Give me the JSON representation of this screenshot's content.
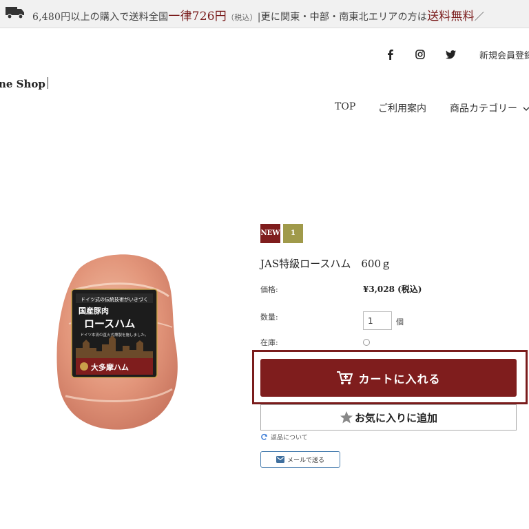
{
  "banner": {
    "truck_icon": "truck-icon",
    "part1": "6,480円以上の購入で送料全国",
    "highlight1": "一律726円",
    "tax": "（税込）",
    "part2": "|更に関東・中部・南東北エリアの方は",
    "highlight2": "送料無料",
    "end": "／"
  },
  "header": {
    "social_icons": [
      "facebook-icon",
      "instagram-icon",
      "twitter-icon"
    ],
    "register_label": "新規会員登録",
    "shop_name": "ne Shop"
  },
  "nav": {
    "items": [
      "TOP",
      "ご利用案内",
      "商品カテゴリー"
    ]
  },
  "product": {
    "badges": [
      "NEW",
      "1"
    ],
    "title": "JAS特級ロースハム　600ｇ",
    "price_label": "価格:",
    "price": "¥3,028 (税込)",
    "quantity_label": "数量:",
    "quantity_value": "1",
    "quantity_unit": "個",
    "stock_label": "在庫:",
    "package": {
      "line1": "ドイツ式の伝統技術がいきづく",
      "line2": "国産豚肉",
      "line3": "ロースハム",
      "line4": "ドイツ本流の直火式燻製を施しました。",
      "brand": "大多摩ハム"
    }
  },
  "actions": {
    "cart_label": "カートに入れる",
    "favorite_label": "お気に入りに追加",
    "return_label": "返品について",
    "mail_label": "メールで送る"
  },
  "colors": {
    "brand": "#7f1d1d",
    "badge_new": "#7f1d1d",
    "badge_num": "#a09a4a"
  }
}
